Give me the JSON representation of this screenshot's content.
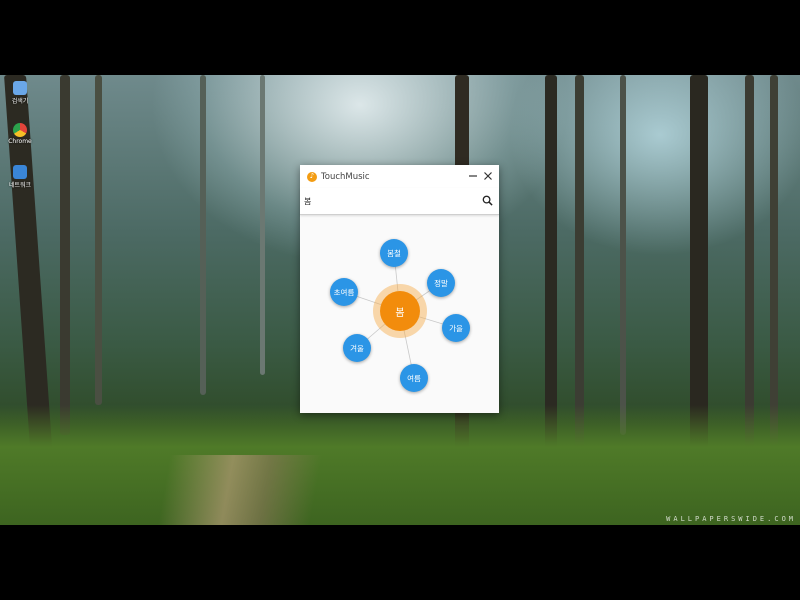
{
  "desktop": {
    "icons": [
      {
        "label": "검색기",
        "icon": "search-app-icon",
        "color": "#6aa7e8"
      },
      {
        "label": "Chrome",
        "icon": "chrome-icon",
        "color": "#e3443a"
      },
      {
        "label": "네트워크",
        "icon": "network-icon",
        "color": "#3a86d8"
      }
    ],
    "watermark": "WALLPAPERSWIDE.COM"
  },
  "window": {
    "title": "TouchMusic",
    "search": {
      "value": "봄",
      "placeholder": ""
    }
  },
  "graph": {
    "center": "봄",
    "nodes": [
      "봄철",
      "초여름",
      "정말",
      "가을",
      "겨울",
      "여름"
    ]
  },
  "colors": {
    "accent": "#f28c0c",
    "node": "#2b95e6"
  }
}
